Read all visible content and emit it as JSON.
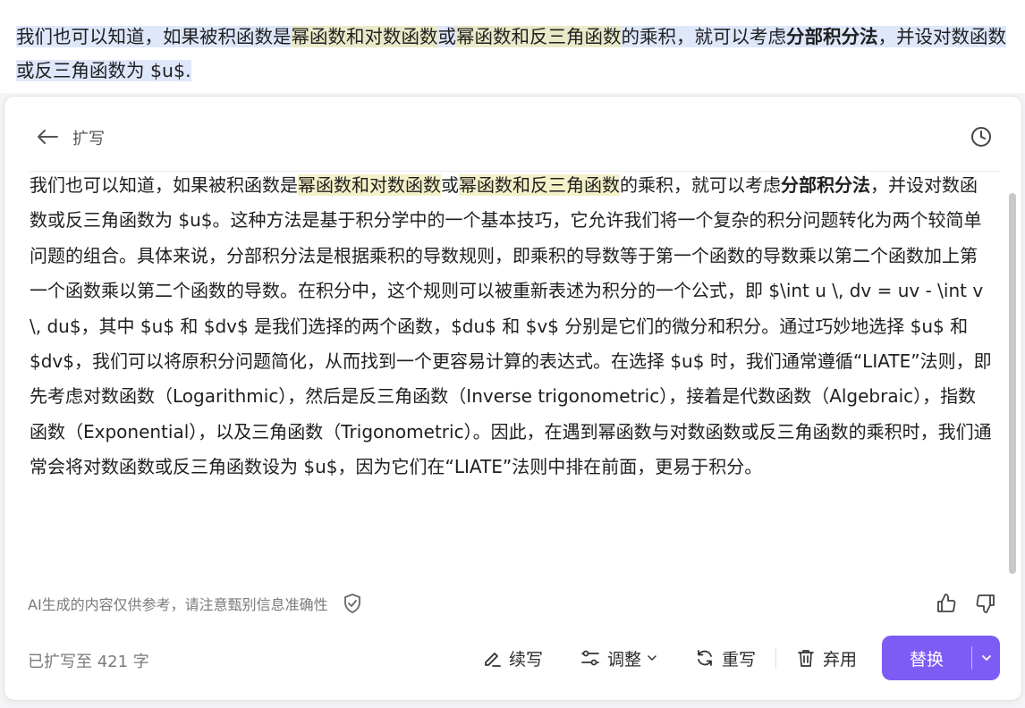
{
  "document": {
    "part1": "我们也可以知道，如果被积函数是",
    "hl1": "幂函数和对数函数",
    "part2": "或",
    "hl2": "幂函数和反三角函数",
    "part3": "的乘积，就可以考虑",
    "bold": "分部积分法",
    "part4": "，并设对数函数或反三角函数为 $u$."
  },
  "panel": {
    "title": "扩写",
    "content": {
      "part1": "我们也可以知道，如果被积函数是",
      "hl1": "幂函数和对数函数",
      "part2": "或",
      "hl2": "幂函数和反三角函数",
      "part3": "的乘积，就可以考虑",
      "bold": "分部积分法",
      "part4": "，并设对数函数或反三角函数为 $u$。这种方法是基于积分学中的一个基本技巧，它允许我们将一个复杂的积分问题转化为两个较简单问题的组合。具体来说，分部积分法是根据乘积的导数规则，即乘积的导数等于第一个函数的导数乘以第二个函数加上第一个函数乘以第二个函数的导数。在积分中，这个规则可以被重新表述为积分的一个公式，即 $\\int u \\, dv = uv - \\int v \\, du$，其中 $u$ 和 $dv$ 是我们选择的两个函数，$du$ 和 $v$ 分别是它们的微分和积分。通过巧妙地选择 $u$ 和 $dv$，我们可以将原积分问题简化，从而找到一个更容易计算的表达式。在选择 $u$ 时，我们通常遵循“LIATE”法则，即先考虑对数函数（Logarithmic），然后是反三角函数（Inverse trigonometric），接着是代数函数（Algebraic），指数函数（Exponential），以及三角函数（Trigonometric）。因此，在遇到幂函数与对数函数或反三角函数的乘积时，我们通常会将对数函数或反三角函数设为 $u$，因为它们在“LIATE”法则中排在前面，更易于积分。"
    },
    "disclaimer": "AI生成的内容仅供参考，请注意甄别信息准确性",
    "word_count": "已扩写至 421 字",
    "actions": {
      "continue": "续写",
      "adjust": "调整",
      "rewrite": "重写",
      "discard": "弃用",
      "replace": "替换"
    }
  },
  "colors": {
    "accent": "#7d5cf5",
    "selection": "#dfe7fb",
    "highlight": "#e9eac9"
  }
}
